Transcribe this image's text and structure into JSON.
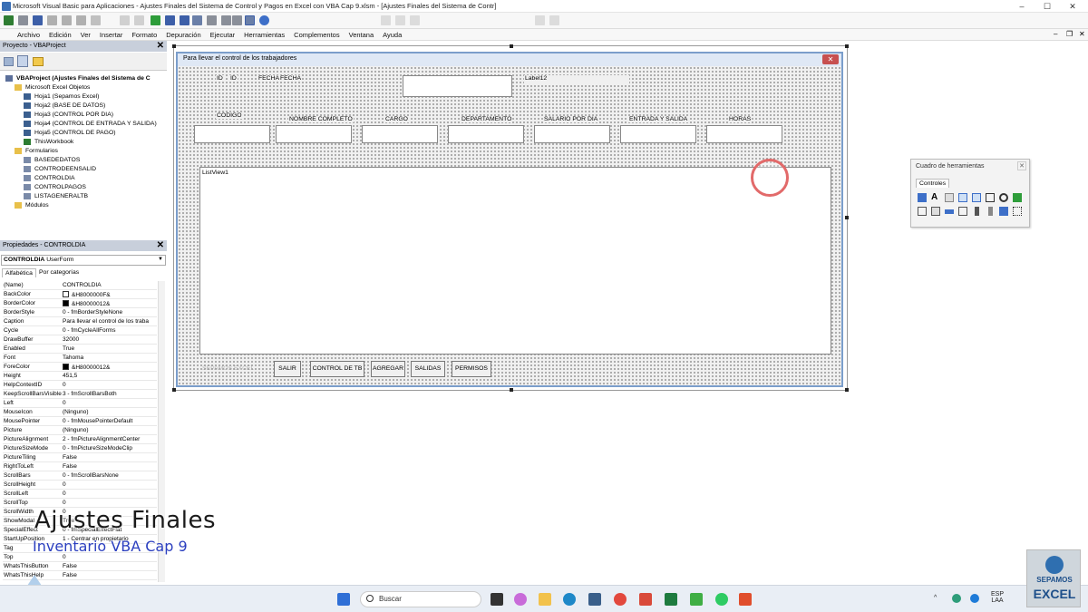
{
  "window": {
    "title": "Microsoft Visual Basic para Aplicaciones - Ajustes Finales del Sistema de Control y Pagos en Excel con VBA  Cap 9.xlsm - [Ajustes Finales del Sistema de Contr]",
    "minimize": "–",
    "maximize": "☐",
    "close": "✕",
    "inner_min": "–",
    "inner_restore": "❐",
    "inner_close": "✕"
  },
  "menu": [
    "Archivo",
    "Edición",
    "Ver",
    "Insertar",
    "Formato",
    "Depuración",
    "Ejecutar",
    "Herramientas",
    "Complementos",
    "Ventana",
    "Ayuda"
  ],
  "project": {
    "header": "Proyecto - VBAProject",
    "close": "✕",
    "tree": [
      {
        "label": "VBAProject (Ajustes Finales del Sistema de C",
        "level": 0,
        "bold": true,
        "icon": "vba-project-icon"
      },
      {
        "label": "Microsoft Excel Objetos",
        "level": 1,
        "icon": "folder-icon"
      },
      {
        "label": "Hoja1 (Sepamos Excel)",
        "level": 2,
        "icon": "sheet-icon"
      },
      {
        "label": "Hoja2 (BASE DE DATOS)",
        "level": 2,
        "icon": "sheet-icon"
      },
      {
        "label": "Hoja3 (CONTROL POR DIA)",
        "level": 2,
        "icon": "sheet-icon"
      },
      {
        "label": "Hoja4 (CONTROL DE ENTRADA Y SALIDA)",
        "level": 2,
        "icon": "sheet-icon"
      },
      {
        "label": "Hoja5 (CONTROL DE PAGO)",
        "level": 2,
        "icon": "sheet-icon"
      },
      {
        "label": "ThisWorkbook",
        "level": 2,
        "icon": "workbook-icon"
      },
      {
        "label": "Formularios",
        "level": 1,
        "icon": "folder-icon"
      },
      {
        "label": "BASEDEDATOS",
        "level": 2,
        "icon": "form-icon"
      },
      {
        "label": "CONTRODEENSALID",
        "level": 2,
        "icon": "form-icon"
      },
      {
        "label": "CONTROLDIA",
        "level": 2,
        "icon": "form-icon"
      },
      {
        "label": "CONTROLPAGOS",
        "level": 2,
        "icon": "form-icon"
      },
      {
        "label": "LISTAGENERALTB",
        "level": 2,
        "icon": "form-icon"
      },
      {
        "label": "Módulos",
        "level": 1,
        "icon": "folder-icon"
      }
    ]
  },
  "properties": {
    "header": "Propiedades - CONTROLDIA",
    "close": "✕",
    "object_name": "CONTROLDIA",
    "object_type": "UserForm",
    "tab_alpha": "Alfabética",
    "tab_cat": "Por categorías",
    "rows": [
      {
        "name": "(Name)",
        "value": "CONTROLDIA"
      },
      {
        "name": "BackColor",
        "value": "&H8000000F&",
        "swatch": "#ffffff"
      },
      {
        "name": "BorderColor",
        "value": "&H80000012&",
        "swatch": "#000000"
      },
      {
        "name": "BorderStyle",
        "value": "0 - fmBorderStyleNone"
      },
      {
        "name": "Caption",
        "value": "Para llevar el control de los traba"
      },
      {
        "name": "Cycle",
        "value": "0 - fmCycleAllForms"
      },
      {
        "name": "DrawBuffer",
        "value": "32000"
      },
      {
        "name": "Enabled",
        "value": "True"
      },
      {
        "name": "Font",
        "value": "Tahoma"
      },
      {
        "name": "ForeColor",
        "value": "&H80000012&",
        "swatch": "#000000"
      },
      {
        "name": "Height",
        "value": "451,5"
      },
      {
        "name": "HelpContextID",
        "value": "0"
      },
      {
        "name": "KeepScrollBarsVisible",
        "value": "3 - fmScrollBarsBoth"
      },
      {
        "name": "Left",
        "value": "0"
      },
      {
        "name": "MouseIcon",
        "value": "(Ninguno)"
      },
      {
        "name": "MousePointer",
        "value": "0 - fmMousePointerDefault"
      },
      {
        "name": "Picture",
        "value": "(Ninguno)"
      },
      {
        "name": "PictureAlignment",
        "value": "2 - fmPictureAlignmentCenter"
      },
      {
        "name": "PictureSizeMode",
        "value": "0 - fmPictureSizeModeClip"
      },
      {
        "name": "PictureTiling",
        "value": "False"
      },
      {
        "name": "RightToLeft",
        "value": "False"
      },
      {
        "name": "ScrollBars",
        "value": "0 - fmScrollBarsNone"
      },
      {
        "name": "ScrollHeight",
        "value": "0"
      },
      {
        "name": "ScrollLeft",
        "value": "0"
      },
      {
        "name": "ScrollTop",
        "value": "0"
      },
      {
        "name": "ScrollWidth",
        "value": "0"
      },
      {
        "name": "ShowModal",
        "value": "True"
      },
      {
        "name": "SpecialEffect",
        "value": "0 - fmSpecialEffectFlat"
      },
      {
        "name": "StartUpPosition",
        "value": "1 - Centrar en propietario"
      },
      {
        "name": "Tag",
        "value": ""
      },
      {
        "name": "Top",
        "value": "0"
      },
      {
        "name": "WhatsThisButton",
        "value": "False"
      },
      {
        "name": "WhatsThisHelp",
        "value": "False"
      }
    ]
  },
  "userform": {
    "caption": "Para llevar el control de los trabajadores",
    "close": "✕",
    "label_id": "ID",
    "value_id": "ID",
    "label_fecha": "FECHA",
    "value_fecha": "FECHA",
    "label12": "Label12",
    "columns": [
      "CODIGO",
      "NOMBRE COMPLETO",
      "CARGO",
      "DEPARTAMENTO",
      "SALARIO POR DIA",
      "ENTRADA Y SALIDA",
      "HORAS"
    ],
    "listview": "ListView1",
    "watermark_button": "SEPAMOS EXCEL",
    "buttons": [
      "SALIR",
      "CONTROL DE TB",
      "AGREGAR",
      "SALIDAS",
      "PERMISOS"
    ]
  },
  "toolbox": {
    "title": "Cuadro de herramientas",
    "close": "✕",
    "tab": "Controles"
  },
  "overlay": {
    "title": "Ajustes Finales",
    "subtitle": "Inventario VBA Cap 9"
  },
  "taskbar": {
    "search": "Buscar",
    "lang1": "ESP",
    "lang2": "LAA"
  },
  "logo": {
    "line1": "SEPAMOS",
    "line2": "EXCEL"
  }
}
